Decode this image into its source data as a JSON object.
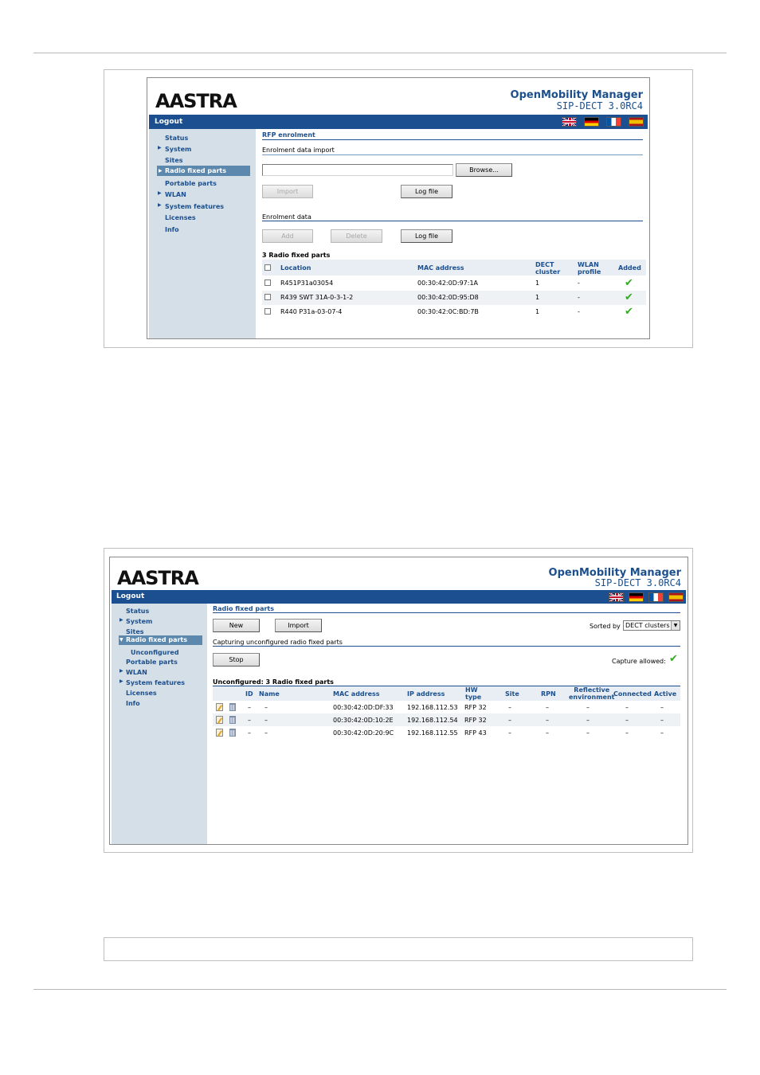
{
  "shot1": {
    "brand_title": "OpenMobility Manager",
    "brand_version": "SIP-DECT 3.0RC4",
    "logout_label": "Logout",
    "nav": [
      {
        "label": "Status"
      },
      {
        "label": "System"
      },
      {
        "label": "Sites"
      },
      {
        "label": "Radio fixed parts"
      },
      {
        "label": "Portable parts"
      },
      {
        "label": "WLAN"
      },
      {
        "label": "System features"
      },
      {
        "label": "Licenses"
      },
      {
        "label": "Info"
      }
    ],
    "section_title": "RFP enrolment",
    "import_section": "Enrolment data import",
    "browse_label": "Browse...",
    "import_label": "Import",
    "logfile_label": "Log file",
    "data_section": "Enrolment data",
    "add_label": "Add",
    "delete_label": "Delete",
    "logfile2_label": "Log file",
    "table_title": "3 Radio fixed parts",
    "columns": {
      "location": "Location",
      "mac": "MAC address",
      "dect1": "DECT",
      "dect2": "cluster",
      "wlan1": "WLAN",
      "wlan2": "profile",
      "added": "Added"
    },
    "rows": [
      {
        "location": "R451P31a03054",
        "mac": "00:30:42:0D:97:1A",
        "dect": "1",
        "wlan": "-"
      },
      {
        "location": "R439 SWT 31A-0-3-1-2",
        "mac": "00:30:42:0D:95:D8",
        "dect": "1",
        "wlan": "-"
      },
      {
        "location": "R440 P31a-03-07-4",
        "mac": "00:30:42:0C:BD:7B",
        "dect": "1",
        "wlan": "-"
      }
    ],
    "logo": "AASTRA",
    "flags": [
      "uk-flag",
      "de-flag",
      "fr-flag",
      "es-flag"
    ]
  },
  "shot2": {
    "brand_title": "OpenMobility Manager",
    "brand_version": "SIP-DECT 3.0RC4",
    "logout_label": "Logout",
    "logo": "AASTRA",
    "nav": [
      {
        "label": "Status"
      },
      {
        "label": "System"
      },
      {
        "label": "Sites"
      },
      {
        "label": "Radio fixed parts"
      },
      {
        "label": "Unconfigured"
      },
      {
        "label": "Portable parts"
      },
      {
        "label": "WLAN"
      },
      {
        "label": "System features"
      },
      {
        "label": "Licenses"
      },
      {
        "label": "Info"
      }
    ],
    "section_title": "Radio fixed parts",
    "new_label": "New",
    "import_label": "Import",
    "sorted_by_label": "Sorted by",
    "sorted_by_value": "DECT clusters",
    "capture_section": "Capturing unconfigured radio fixed parts",
    "stop_label": "Stop",
    "capture_allowed_label": "Capture allowed:",
    "table_title": "Unconfigured: 3 Radio fixed parts",
    "columns": {
      "id": "ID",
      "name": "Name",
      "mac": "MAC address",
      "ip": "IP address",
      "hw1": "HW",
      "hw2": "type",
      "site": "Site",
      "rpn": "RPN",
      "refl1": "Reflective",
      "refl2": "environment",
      "connected": "Connected",
      "active": "Active"
    },
    "rows": [
      {
        "id": "–",
        "name": "–",
        "mac": "00:30:42:0D:DF:33",
        "ip": "192.168.112.53",
        "hw": "RFP 32",
        "site": "–",
        "rpn": "–",
        "refl": "–",
        "connected": "–",
        "active": "–"
      },
      {
        "id": "–",
        "name": "–",
        "mac": "00:30:42:0D:10:2E",
        "ip": "192.168.112.54",
        "hw": "RFP 32",
        "site": "–",
        "rpn": "–",
        "refl": "–",
        "connected": "–",
        "active": "–"
      },
      {
        "id": "–",
        "name": "–",
        "mac": "00:30:42:0D:20:9C",
        "ip": "192.168.112.55",
        "hw": "RFP 43",
        "site": "–",
        "rpn": "–",
        "refl": "–",
        "connected": "–",
        "active": "–"
      }
    ]
  },
  "colors": {
    "accent": "#1b4f8f",
    "sidebar": "#d4dfe8",
    "selected": "#5c88ad",
    "check": "#33aa22"
  }
}
